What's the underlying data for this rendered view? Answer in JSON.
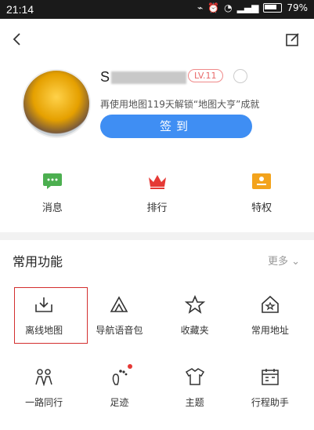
{
  "status": {
    "time": "21:14",
    "battery": "79%"
  },
  "profile": {
    "name_visible": "S",
    "level": "LV.11",
    "hint": "再使用地图119天解锁“地图大亨”成就",
    "signin": "签到"
  },
  "quick": [
    {
      "label": "消息",
      "icon": "message-icon"
    },
    {
      "label": "排行",
      "icon": "crown-icon"
    },
    {
      "label": "特权",
      "icon": "privilege-icon"
    }
  ],
  "features": {
    "title": "常用功能",
    "more": "更多",
    "items": [
      {
        "label": "离线地图",
        "icon": "offline-map-icon",
        "selected": true
      },
      {
        "label": "导航语音包",
        "icon": "voice-pack-icon"
      },
      {
        "label": "收藏夹",
        "icon": "star-icon"
      },
      {
        "label": "常用地址",
        "icon": "home-star-icon"
      },
      {
        "label": "一路同行",
        "icon": "people-icon"
      },
      {
        "label": "足迹",
        "icon": "footprint-icon",
        "badge": true
      },
      {
        "label": "主题",
        "icon": "theme-icon"
      },
      {
        "label": "行程助手",
        "icon": "calendar-icon"
      }
    ]
  },
  "colors": {
    "accent": "#3f8ef3",
    "level": "#e86a6a",
    "selected_border": "#d32f2f",
    "message": "#4caf50",
    "crown": "#e53935",
    "privilege": "#f3a31c"
  }
}
